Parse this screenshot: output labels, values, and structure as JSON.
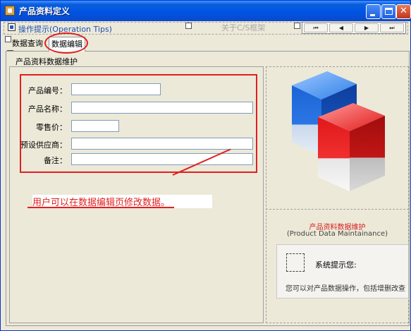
{
  "window": {
    "title": "产品资料定义"
  },
  "toolbar": {
    "tip_label": "操作提示(Operation Tips)",
    "about_label": "关于C/S框架",
    "nav": {
      "first": "⏮",
      "prev": "◀",
      "next": "▶",
      "last": "⏭"
    }
  },
  "tabs": [
    {
      "label": "数据查询"
    },
    {
      "label": "数据编辑"
    }
  ],
  "form": {
    "group_title": "产品资料数据维护",
    "fields": [
      {
        "label": "产品编号：",
        "value": ""
      },
      {
        "label": "产品名称：",
        "value": ""
      },
      {
        "label": "零售价：",
        "value": ""
      },
      {
        "label": "预设供应商：",
        "value": ""
      },
      {
        "label": "备注：",
        "value": ""
      }
    ]
  },
  "annotation": {
    "note": "用户可以在数据编辑页修改数据。"
  },
  "sidebar": {
    "title": "产品资料数据维护",
    "subtitle": "(Product Data Maintainance)",
    "sys_label": "系统提示您:",
    "sys_message": "您可以对产品数据操作，包括增删改查"
  },
  "colors": {
    "accent_red": "#E02020",
    "title_blue": "#0054E3",
    "cube_blue": "#1E6FE0",
    "cube_red": "#E21B1B"
  }
}
